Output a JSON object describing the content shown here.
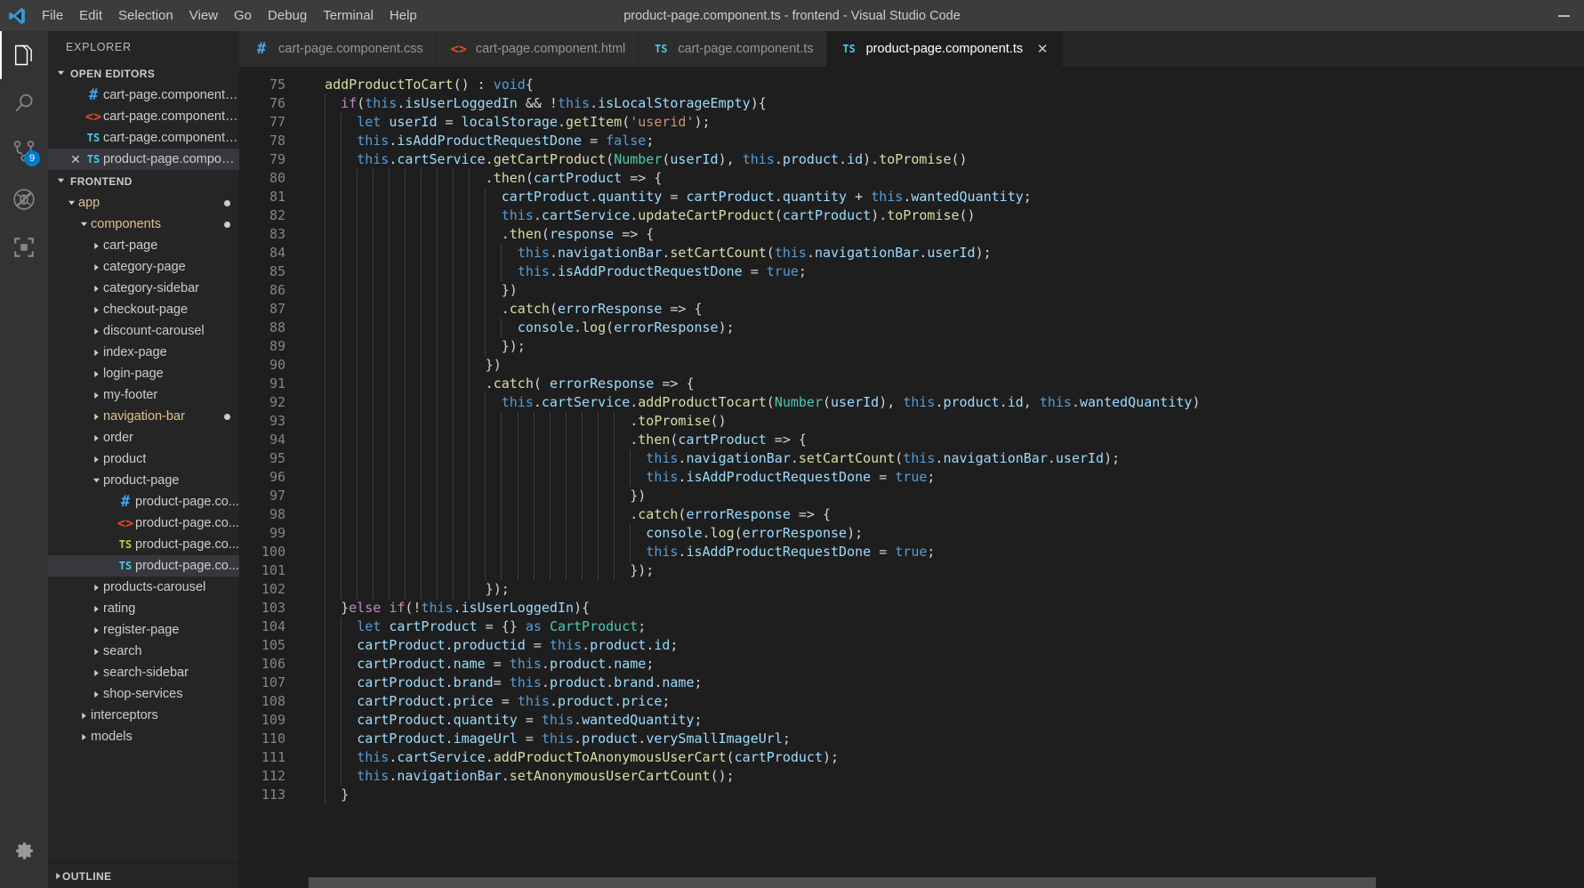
{
  "window": {
    "title": "product-page.component.ts - frontend - Visual Studio Code",
    "minimize_label": "—"
  },
  "menubar": {
    "items": [
      {
        "label": "File"
      },
      {
        "label": "Edit"
      },
      {
        "label": "Selection"
      },
      {
        "label": "View"
      },
      {
        "label": "Go"
      },
      {
        "label": "Debug"
      },
      {
        "label": "Terminal"
      },
      {
        "label": "Help"
      }
    ]
  },
  "activitybar": {
    "items": [
      {
        "name": "explorer",
        "icon": "files-icon",
        "active": true,
        "badge": ""
      },
      {
        "name": "search",
        "icon": "search-icon",
        "active": false,
        "badge": ""
      },
      {
        "name": "source-control",
        "icon": "source-control-icon",
        "active": false,
        "badge": "9"
      },
      {
        "name": "debug",
        "icon": "debug-icon",
        "active": false,
        "badge": ""
      },
      {
        "name": "extensions",
        "icon": "extensions-icon",
        "active": false,
        "badge": ""
      }
    ],
    "bottom": [
      {
        "name": "manage",
        "icon": "gear-icon"
      }
    ]
  },
  "sidebar": {
    "title": "EXPLORER",
    "open_editors": {
      "header": "OPEN EDITORS",
      "expanded": true,
      "items": [
        {
          "label": "cart-page.component....",
          "icon": "css",
          "selected": false,
          "closable": false
        },
        {
          "label": "cart-page.component....",
          "icon": "html",
          "selected": false,
          "closable": false
        },
        {
          "label": "cart-page.component....",
          "icon": "ts",
          "selected": false,
          "closable": false
        },
        {
          "label": "product-page.compon...",
          "icon": "ts",
          "selected": true,
          "closable": true,
          "close": "✕"
        }
      ]
    },
    "workspace": {
      "header": "FRONTEND",
      "expanded": true,
      "items": [
        {
          "label": "app",
          "depth": 1,
          "type": "folder",
          "state": "open",
          "modified": true,
          "dot": true
        },
        {
          "label": "components",
          "depth": 2,
          "type": "folder",
          "state": "open",
          "modified": true,
          "dot": true
        },
        {
          "label": "cart-page",
          "depth": 3,
          "type": "folder",
          "state": "closed",
          "modified": false,
          "dot": false
        },
        {
          "label": "category-page",
          "depth": 3,
          "type": "folder",
          "state": "closed",
          "modified": false,
          "dot": false
        },
        {
          "label": "category-sidebar",
          "depth": 3,
          "type": "folder",
          "state": "closed",
          "modified": false,
          "dot": false
        },
        {
          "label": "checkout-page",
          "depth": 3,
          "type": "folder",
          "state": "closed",
          "modified": false,
          "dot": false
        },
        {
          "label": "discount-carousel",
          "depth": 3,
          "type": "folder",
          "state": "closed",
          "modified": false,
          "dot": false
        },
        {
          "label": "index-page",
          "depth": 3,
          "type": "folder",
          "state": "closed",
          "modified": false,
          "dot": false
        },
        {
          "label": "login-page",
          "depth": 3,
          "type": "folder",
          "state": "closed",
          "modified": false,
          "dot": false
        },
        {
          "label": "my-footer",
          "depth": 3,
          "type": "folder",
          "state": "closed",
          "modified": false,
          "dot": false
        },
        {
          "label": "navigation-bar",
          "depth": 3,
          "type": "folder",
          "state": "closed",
          "modified": true,
          "dot": true
        },
        {
          "label": "order",
          "depth": 3,
          "type": "folder",
          "state": "closed",
          "modified": false,
          "dot": false
        },
        {
          "label": "product",
          "depth": 3,
          "type": "folder",
          "state": "closed",
          "modified": false,
          "dot": false
        },
        {
          "label": "product-page",
          "depth": 3,
          "type": "folder",
          "state": "open",
          "modified": false,
          "dot": false
        },
        {
          "label": "product-page.co...",
          "depth": 4,
          "type": "file",
          "icon": "css",
          "selected": false
        },
        {
          "label": "product-page.co...",
          "depth": 4,
          "type": "file",
          "icon": "html",
          "selected": false
        },
        {
          "label": "product-page.co...",
          "depth": 4,
          "type": "file",
          "icon": "ts-yellow",
          "selected": false
        },
        {
          "label": "product-page.co...",
          "depth": 4,
          "type": "file",
          "icon": "ts",
          "selected": true
        },
        {
          "label": "products-carousel",
          "depth": 3,
          "type": "folder",
          "state": "closed",
          "modified": false,
          "dot": false
        },
        {
          "label": "rating",
          "depth": 3,
          "type": "folder",
          "state": "closed",
          "modified": false,
          "dot": false
        },
        {
          "label": "register-page",
          "depth": 3,
          "type": "folder",
          "state": "closed",
          "modified": false,
          "dot": false
        },
        {
          "label": "search",
          "depth": 3,
          "type": "folder",
          "state": "closed",
          "modified": false,
          "dot": false
        },
        {
          "label": "search-sidebar",
          "depth": 3,
          "type": "folder",
          "state": "closed",
          "modified": false,
          "dot": false
        },
        {
          "label": "shop-services",
          "depth": 3,
          "type": "folder",
          "state": "closed",
          "modified": false,
          "dot": false
        },
        {
          "label": "interceptors",
          "depth": 2,
          "type": "folder",
          "state": "closed",
          "modified": false,
          "dot": false
        },
        {
          "label": "models",
          "depth": 2,
          "type": "folder",
          "state": "closed",
          "modified": false,
          "dot": false
        }
      ]
    },
    "outline": {
      "header": "OUTLINE",
      "expanded": false
    }
  },
  "tabs": [
    {
      "label": "cart-page.component.css",
      "icon": "css",
      "active": false
    },
    {
      "label": "cart-page.component.html",
      "icon": "html",
      "active": false
    },
    {
      "label": "cart-page.component.ts",
      "icon": "ts",
      "active": false
    },
    {
      "label": "product-page.component.ts",
      "icon": "ts",
      "active": true,
      "close": "✕"
    }
  ],
  "editor": {
    "file": "product-page.component.ts",
    "language": "typescript",
    "first_line": 75,
    "last_line": 113,
    "lines": [
      {
        "n": 75,
        "text": "  addProductToCart() : void{"
      },
      {
        "n": 76,
        "text": "    if(this.isUserLoggedIn && !this.isLocalStorageEmpty){"
      },
      {
        "n": 77,
        "text": "      let userId = localStorage.getItem('userid');"
      },
      {
        "n": 78,
        "text": "      this.isAddProductRequestDone = false;"
      },
      {
        "n": 79,
        "text": "      this.cartService.getCartProduct(Number(userId), this.product.id).toPromise()"
      },
      {
        "n": 80,
        "text": "                      .then(cartProduct => {"
      },
      {
        "n": 81,
        "text": "                        cartProduct.quantity = cartProduct.quantity + this.wantedQuantity;"
      },
      {
        "n": 82,
        "text": "                        this.cartService.updateCartProduct(cartProduct).toPromise()"
      },
      {
        "n": 83,
        "text": "                        .then(response => {"
      },
      {
        "n": 84,
        "text": "                          this.navigationBar.setCartCount(this.navigationBar.userId);"
      },
      {
        "n": 85,
        "text": "                          this.isAddProductRequestDone = true;"
      },
      {
        "n": 86,
        "text": "                        })"
      },
      {
        "n": 87,
        "text": "                        .catch(errorResponse => {"
      },
      {
        "n": 88,
        "text": "                          console.log(errorResponse);"
      },
      {
        "n": 89,
        "text": "                        });"
      },
      {
        "n": 90,
        "text": "                      })"
      },
      {
        "n": 91,
        "text": "                      .catch( errorResponse => {"
      },
      {
        "n": 92,
        "text": "                        this.cartService.addProductTocart(Number(userId), this.product.id, this.wantedQuantity)"
      },
      {
        "n": 93,
        "text": "                                        .toPromise()"
      },
      {
        "n": 94,
        "text": "                                        .then(cartProduct => {"
      },
      {
        "n": 95,
        "text": "                                          this.navigationBar.setCartCount(this.navigationBar.userId);"
      },
      {
        "n": 96,
        "text": "                                          this.isAddProductRequestDone = true;"
      },
      {
        "n": 97,
        "text": "                                        })"
      },
      {
        "n": 98,
        "text": "                                        .catch(errorResponse => {"
      },
      {
        "n": 99,
        "text": "                                          console.log(errorResponse);"
      },
      {
        "n": 100,
        "text": "                                          this.isAddProductRequestDone = true;"
      },
      {
        "n": 101,
        "text": "                                        });"
      },
      {
        "n": 102,
        "text": "                      });"
      },
      {
        "n": 103,
        "text": "    }else if(!this.isUserLoggedIn){"
      },
      {
        "n": 104,
        "text": "      let cartProduct = {} as CartProduct;"
      },
      {
        "n": 105,
        "text": "      cartProduct.productid = this.product.id;"
      },
      {
        "n": 106,
        "text": "      cartProduct.name = this.product.name;"
      },
      {
        "n": 107,
        "text": "      cartProduct.brand= this.product.brand.name;"
      },
      {
        "n": 108,
        "text": "      cartProduct.price = this.product.price;"
      },
      {
        "n": 109,
        "text": "      cartProduct.quantity = this.wantedQuantity;"
      },
      {
        "n": 110,
        "text": "      cartProduct.imageUrl = this.product.verySmallImageUrl;"
      },
      {
        "n": 111,
        "text": "      this.cartService.addProductToAnonymousUserCart(cartProduct);"
      },
      {
        "n": 112,
        "text": "      this.navigationBar.setAnonymousUserCartCount();"
      },
      {
        "n": 113,
        "text": "    }"
      }
    ]
  },
  "colors": {
    "accent": "#007acc",
    "titlebar_bg": "#3c3c3c",
    "activitybar_bg": "#333333",
    "sidebar_bg": "#252526",
    "editor_bg": "#1e1e1e",
    "selection_bg": "#37373d",
    "modified_folder": "#e2c08d"
  }
}
